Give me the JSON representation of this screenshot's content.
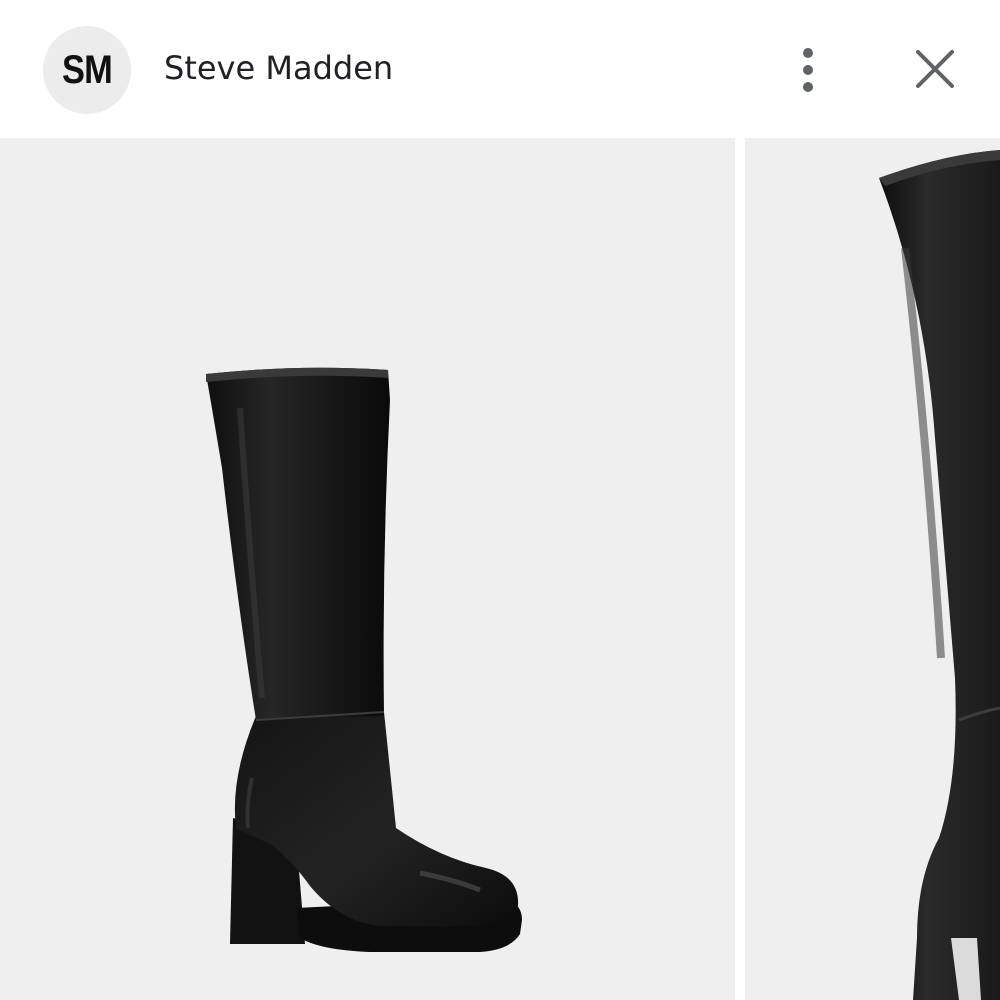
{
  "header": {
    "avatar_initials": "SM",
    "brand_name": "Steve Madden",
    "more_icon": "more-vert-icon",
    "close_icon": "close-icon"
  },
  "gallery": {
    "images": [
      {
        "subject": "black-knee-high-platform-boot",
        "view": "side"
      },
      {
        "subject": "black-knee-high-platform-boot",
        "view": "close-up"
      }
    ]
  },
  "colors": {
    "panel_background": "#efefef",
    "icon_gray": "#5f6368",
    "boot_black": "#1a1a1a"
  }
}
